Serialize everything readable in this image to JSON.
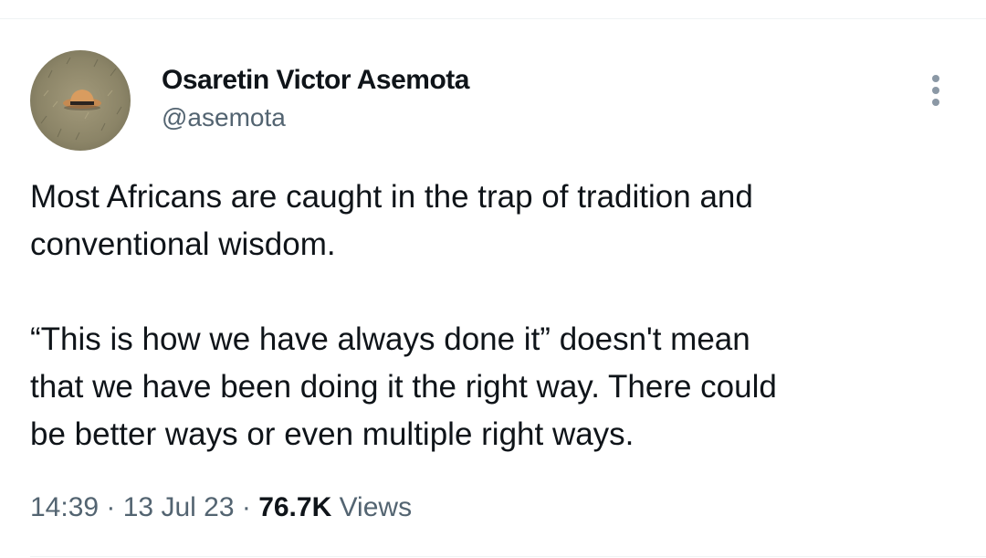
{
  "tweet": {
    "author": {
      "display_name": "Osaretin Victor Asemota",
      "handle": "@asemota"
    },
    "more_icon": "more-vertical-icon",
    "text_paragraphs": [
      "Most Africans are caught in the trap of tradition and\nconventional wisdom.",
      "“This is how we have always done it” doesn't mean\nthat we have been doing it the right way. There could\nbe better ways or even multiple right ways."
    ],
    "meta": {
      "time": "14:39",
      "separator1": " · ",
      "date": "13 Jul 23",
      "separator2": " · ",
      "views_count": "76.7K",
      "views_label": " Views"
    }
  },
  "colors": {
    "text_primary": "#0f1419",
    "text_secondary": "#536471",
    "divider": "#eff3f4"
  }
}
